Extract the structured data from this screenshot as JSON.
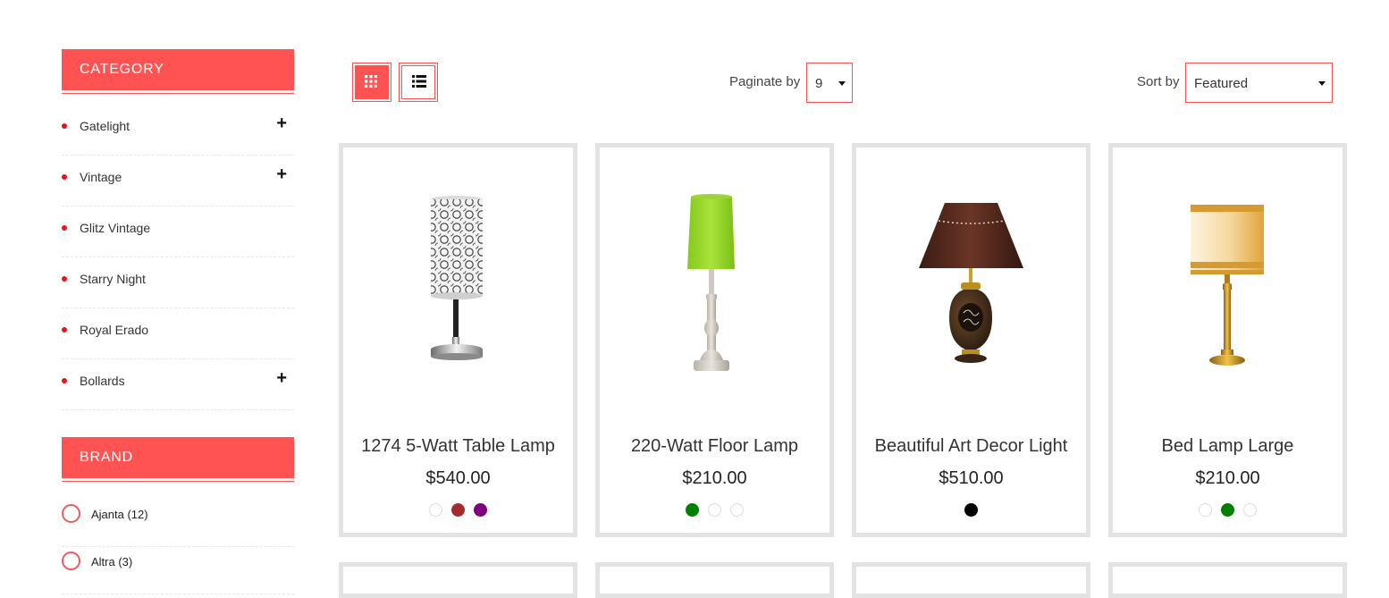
{
  "sidebar": {
    "category_title": "CATEGORY",
    "categories": [
      {
        "label": "Gatelight",
        "expandable": true
      },
      {
        "label": "Vintage",
        "expandable": true
      },
      {
        "label": "Glitz Vintage",
        "expandable": false
      },
      {
        "label": "Starry Night",
        "expandable": false
      },
      {
        "label": "Royal Erado",
        "expandable": false
      },
      {
        "label": "Bollards",
        "expandable": true
      }
    ],
    "expand_symbol": "+",
    "brand_title": "BRAND",
    "brands": [
      {
        "label": "Ajanta (12)"
      },
      {
        "label": "Altra (3)"
      }
    ]
  },
  "toolbar": {
    "grid_view_icon": "grid-icon",
    "list_view_icon": "list-icon",
    "paginate_label": "Paginate by",
    "paginate_value": "9",
    "sort_label": "Sort by",
    "sort_value": "Featured"
  },
  "products": [
    {
      "title": "1274 5-Watt Table Lamp",
      "price": "$540.00",
      "swatches": [
        "#ffffff",
        "#a52a2a",
        "#800080"
      ]
    },
    {
      "title": "220-Watt Floor Lamp",
      "price": "$210.00",
      "swatches": [
        "#008000",
        "#ffffff",
        "#ffffff"
      ]
    },
    {
      "title": "Beautiful Art Decor Light",
      "price": "$510.00",
      "swatches": [
        "#000000"
      ]
    },
    {
      "title": "Bed Lamp Large",
      "price": "$210.00",
      "swatches": [
        "#ffffff",
        "#008000",
        "#ffffff"
      ]
    }
  ],
  "colors": {
    "accent": "#ff5252",
    "dot": "#e3141b",
    "card_border": "#e3e3e3"
  }
}
